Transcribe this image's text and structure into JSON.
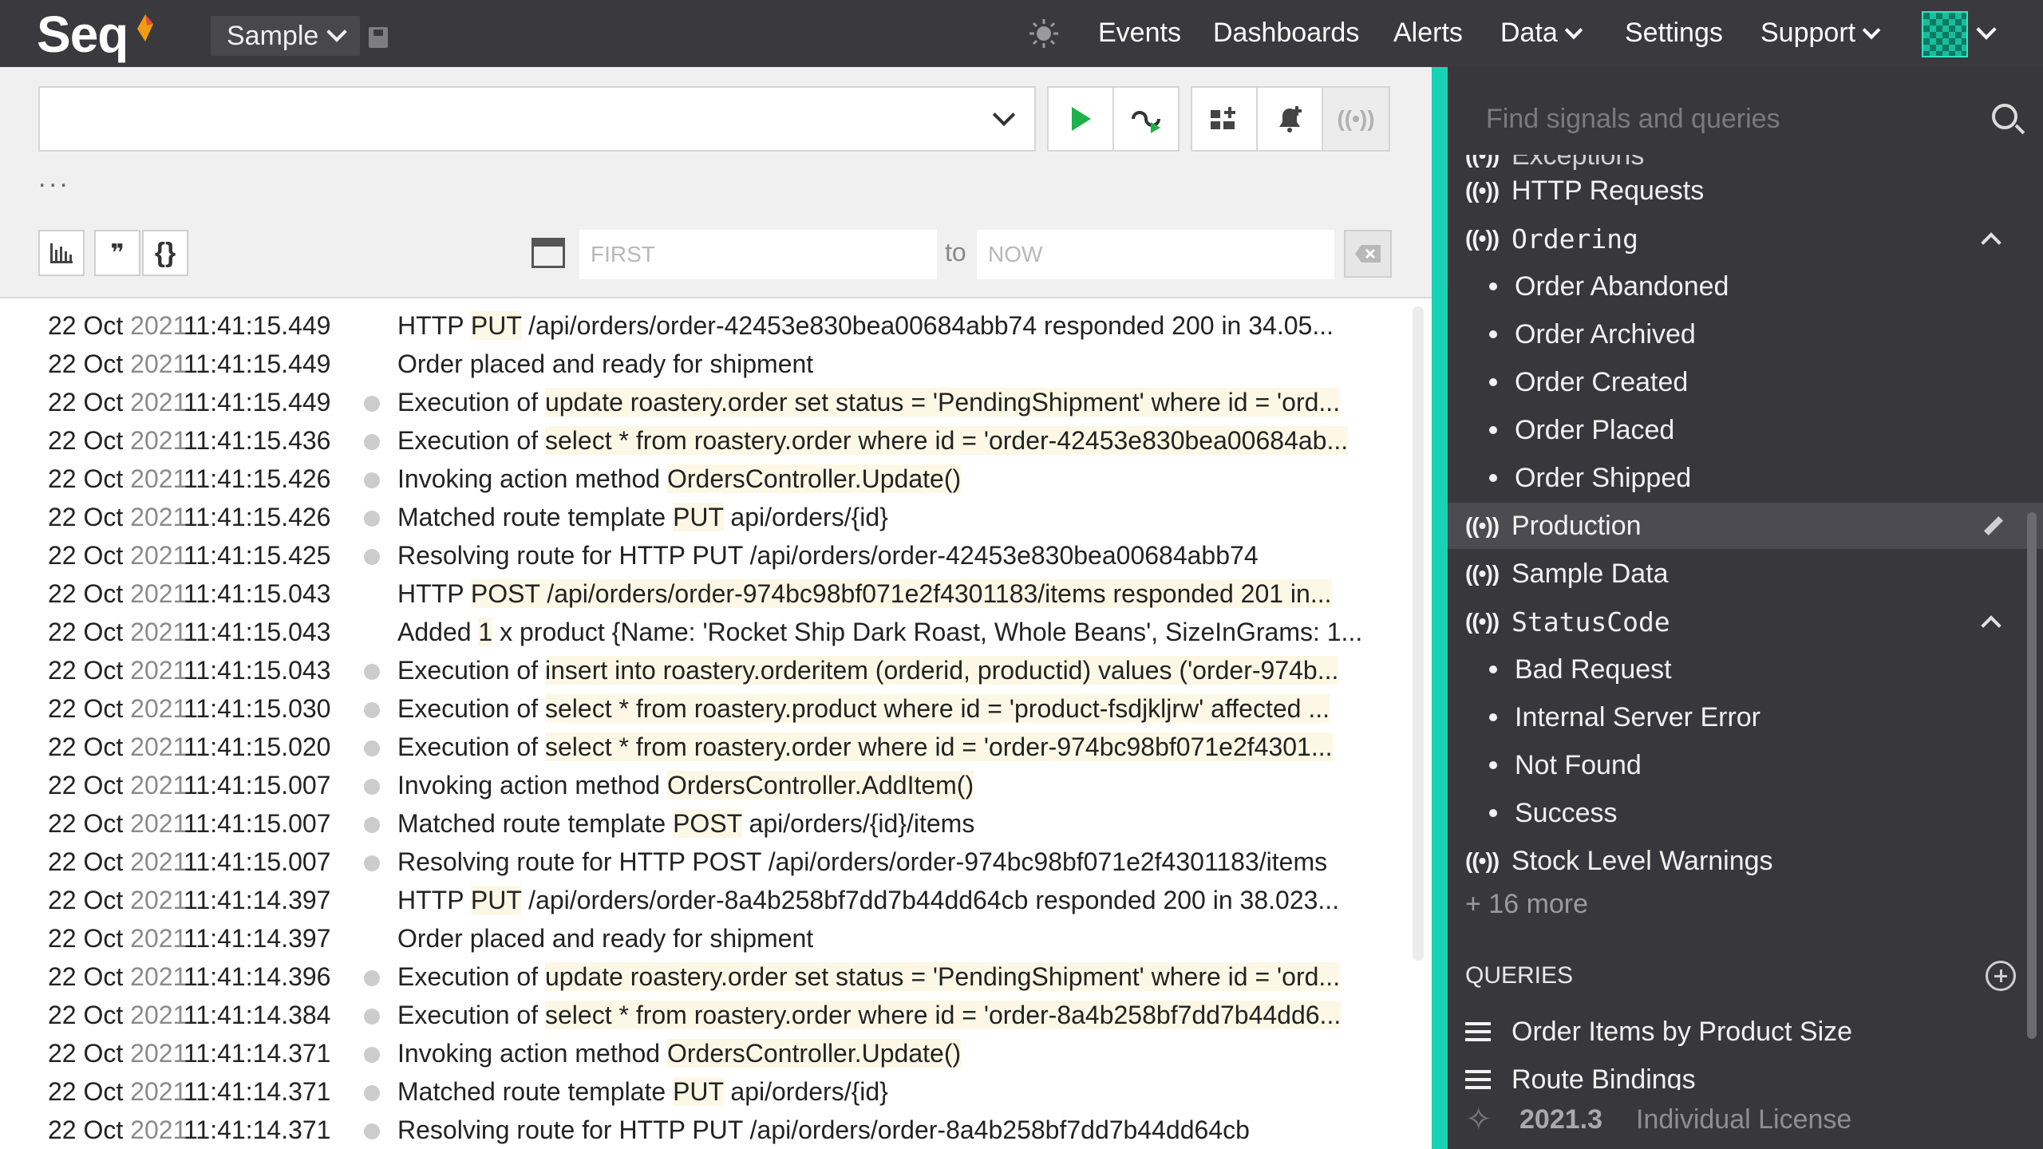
{
  "app": {
    "logo": "Seq",
    "workspace": "Sample"
  },
  "nav": {
    "events": "Events",
    "dashboards": "Dashboards",
    "alerts": "Alerts",
    "data": "Data",
    "settings": "Settings",
    "support": "Support"
  },
  "query": {
    "value": "",
    "ellipsis": "...",
    "format_label": "❞",
    "json_label": "{}",
    "range_from_placeholder": "FIRST",
    "range_to_label": "to",
    "range_to_placeholder": "NOW"
  },
  "events": [
    {
      "day": "22 Oct",
      "year": "2021",
      "time": "11:41:15.449",
      "dot": false,
      "prefix": "HTTP ",
      "hl": "PUT",
      "suffix": " /api/orders/order-42453e830bea00684abb74 responded 200 in 34.05..."
    },
    {
      "day": "22 Oct",
      "year": "2021",
      "time": "11:41:15.449",
      "dot": false,
      "prefix": "Order placed and ready for shipment",
      "hl": "",
      "suffix": ""
    },
    {
      "day": "22 Oct",
      "year": "2021",
      "time": "11:41:15.449",
      "dot": true,
      "prefix": "Execution of ",
      "hl": "update roastery.order set status = 'PendingShipment' where id = 'ord...",
      "suffix": ""
    },
    {
      "day": "22 Oct",
      "year": "2021",
      "time": "11:41:15.436",
      "dot": true,
      "prefix": "Execution of ",
      "hl": "select * from roastery.order where id = 'order-42453e830bea00684ab...",
      "suffix": ""
    },
    {
      "day": "22 Oct",
      "year": "2021",
      "time": "11:41:15.426",
      "dot": true,
      "prefix": "Invoking action method ",
      "hl": "OrdersController.Update()",
      "suffix": ""
    },
    {
      "day": "22 Oct",
      "year": "2021",
      "time": "11:41:15.426",
      "dot": true,
      "prefix": "Matched route template ",
      "hl": "PUT",
      "suffix": " api/orders/{id}"
    },
    {
      "day": "22 Oct",
      "year": "2021",
      "time": "11:41:15.425",
      "dot": true,
      "prefix": "Resolving route for HTTP PUT /api/orders/order-42453e830bea00684abb74",
      "hl": "",
      "suffix": ""
    },
    {
      "day": "22 Oct",
      "year": "2021",
      "time": "11:41:15.043",
      "dot": false,
      "prefix": "HTTP ",
      "hl": "POST /api/orders/order-974bc98bf071e2f4301183/items responded 201 in...",
      "suffix": ""
    },
    {
      "day": "22 Oct",
      "year": "2021",
      "time": "11:41:15.043",
      "dot": false,
      "prefix": "Added ",
      "hl": "1",
      "suffix": " x product {Name: 'Rocket Ship Dark Roast, Whole Beans', SizeInGrams: 1..."
    },
    {
      "day": "22 Oct",
      "year": "2021",
      "time": "11:41:15.043",
      "dot": true,
      "prefix": "Execution of ",
      "hl": "insert into roastery.orderitem (orderid, productid) values ('order-974b...",
      "suffix": ""
    },
    {
      "day": "22 Oct",
      "year": "2021",
      "time": "11:41:15.030",
      "dot": true,
      "prefix": "Execution of ",
      "hl": "select * from roastery.product where id = 'product-fsdjkljrw' affected ...",
      "suffix": ""
    },
    {
      "day": "22 Oct",
      "year": "2021",
      "time": "11:41:15.020",
      "dot": true,
      "prefix": "Execution of ",
      "hl": "select * from roastery.order where id = 'order-974bc98bf071e2f4301...",
      "suffix": ""
    },
    {
      "day": "22 Oct",
      "year": "2021",
      "time": "11:41:15.007",
      "dot": true,
      "prefix": "Invoking action method ",
      "hl": "OrdersController.AddItem()",
      "suffix": ""
    },
    {
      "day": "22 Oct",
      "year": "2021",
      "time": "11:41:15.007",
      "dot": true,
      "prefix": "Matched route template ",
      "hl": "POST",
      "suffix": " api/orders/{id}/items"
    },
    {
      "day": "22 Oct",
      "year": "2021",
      "time": "11:41:15.007",
      "dot": true,
      "prefix": "Resolving route for HTTP POST /api/orders/order-974bc98bf071e2f4301183/items",
      "hl": "",
      "suffix": ""
    },
    {
      "day": "22 Oct",
      "year": "2021",
      "time": "11:41:14.397",
      "dot": false,
      "prefix": "HTTP ",
      "hl": "PUT",
      "suffix": " /api/orders/order-8a4b258bf7dd7b44dd64cb responded 200 in 38.023..."
    },
    {
      "day": "22 Oct",
      "year": "2021",
      "time": "11:41:14.397",
      "dot": false,
      "prefix": "Order placed and ready for shipment",
      "hl": "",
      "suffix": ""
    },
    {
      "day": "22 Oct",
      "year": "2021",
      "time": "11:41:14.396",
      "dot": true,
      "prefix": "Execution of ",
      "hl": "update roastery.order set status = 'PendingShipment' where id = 'ord...",
      "suffix": ""
    },
    {
      "day": "22 Oct",
      "year": "2021",
      "time": "11:41:14.384",
      "dot": true,
      "prefix": "Execution of ",
      "hl": "select * from roastery.order where id = 'order-8a4b258bf7dd7b44dd6...",
      "suffix": ""
    },
    {
      "day": "22 Oct",
      "year": "2021",
      "time": "11:41:14.371",
      "dot": true,
      "prefix": "Invoking action method ",
      "hl": "OrdersController.Update()",
      "suffix": ""
    },
    {
      "day": "22 Oct",
      "year": "2021",
      "time": "11:41:14.371",
      "dot": true,
      "prefix": "Matched route template ",
      "hl": "PUT",
      "suffix": " api/orders/{id}"
    },
    {
      "day": "22 Oct",
      "year": "2021",
      "time": "11:41:14.371",
      "dot": true,
      "prefix": "Resolving route for HTTP PUT /api/orders/order-8a4b258bf7dd7b44dd64cb",
      "hl": "",
      "suffix": ""
    }
  ],
  "sidebar": {
    "search_placeholder": "Find signals and queries",
    "cut_item": "Exceptions",
    "signals": {
      "http_requests": "HTTP Requests",
      "ordering": "Ordering",
      "ordering_children": [
        "Order Abandoned",
        "Order Archived",
        "Order Created",
        "Order Placed",
        "Order Shipped"
      ],
      "production": "Production",
      "sample_data": "Sample Data",
      "status_code": "StatusCode",
      "status_children": [
        "Bad Request",
        "Internal Server Error",
        "Not Found",
        "Success"
      ],
      "stock_level": "Stock Level Warnings",
      "more": "+ 16 more"
    },
    "queries_label": "QUERIES",
    "queries": [
      "Order Items by Product Size",
      "Route Bindings"
    ],
    "version": "2021.3",
    "license": "Individual License"
  },
  "colors": {
    "accent": "#19d2b4",
    "topbar": "#3a3a3e",
    "sidebar": "#38383c",
    "run": "#1fb24a"
  }
}
